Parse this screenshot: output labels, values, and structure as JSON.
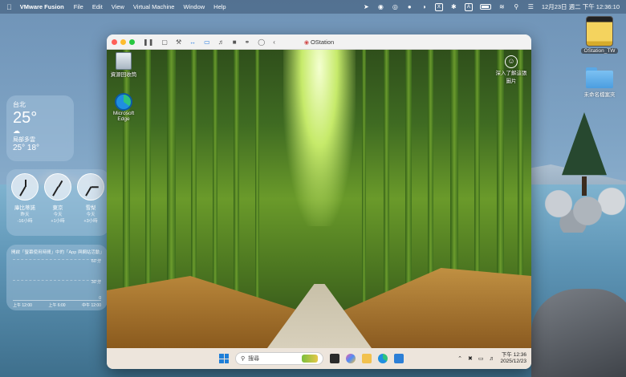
{
  "menubar": {
    "app_name": "VMware Fusion",
    "menus": [
      "File",
      "Edit",
      "View",
      "Virtual Machine",
      "Window",
      "Help"
    ],
    "datetime": "12月23日 週二  下午 12:36:10"
  },
  "weather_widget": {
    "city": "台北",
    "temp": "25°",
    "condition": "局部多雲",
    "hilo": "25° 18°"
  },
  "clocks_widget": {
    "clocks": [
      {
        "name": "庫比蒂諾",
        "day": "昨天",
        "offset": "-16小時",
        "hour_angle": 0,
        "minute_angle": 210
      },
      {
        "name": "東京",
        "day": "今天",
        "offset": "+1小時",
        "hour_angle": 30,
        "minute_angle": 210
      },
      {
        "name": "雪梨",
        "day": "今天",
        "offset": "+3小時",
        "hour_angle": 90,
        "minute_angle": 210
      }
    ]
  },
  "screentime_widget": {
    "title": "開啟「螢幕使用時間」中的「App 與網站活動」",
    "y_labels": [
      "60 分",
      "30 分",
      "0"
    ],
    "x_labels": [
      "上午 12:00",
      "上午 6:00",
      "中午 12:00"
    ]
  },
  "desktop_items": {
    "drive_label": "OStation_TW",
    "folder_label": "未命名檔案夾"
  },
  "vm_window": {
    "title": "OStation",
    "desktop_icons": {
      "recycle_bin": "資源回收筒",
      "edge": "Microsoft Edge",
      "user": "深入了解這張圖片"
    },
    "taskbar": {
      "search_placeholder": "搜尋",
      "time": "下午 12:36",
      "date": "2025/12/23"
    }
  },
  "colors": {
    "menubar_bg": "#3c5573",
    "taskbar_bg": "#ede5dc",
    "windows_blue": "#1f7fd8"
  }
}
